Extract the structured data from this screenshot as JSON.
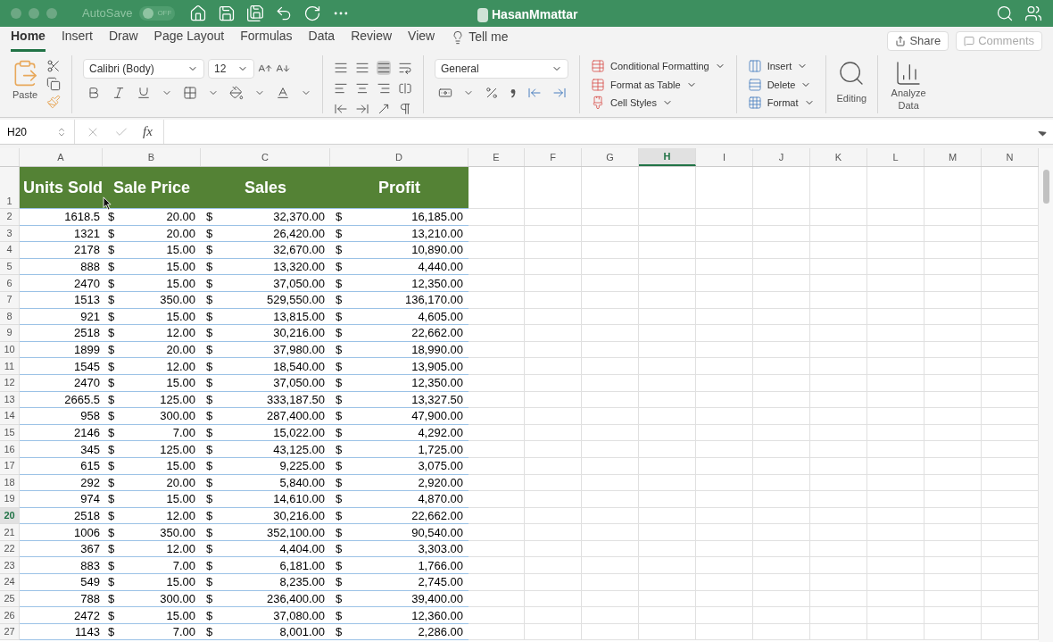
{
  "window": {
    "title": "HasanMmattar",
    "autosave": {
      "label": "AutoSave",
      "toggle": "OFF",
      "on": false
    }
  },
  "tabs": [
    {
      "label": "Home",
      "selected": true
    },
    {
      "label": "Insert",
      "selected": false
    },
    {
      "label": "Draw",
      "selected": false
    },
    {
      "label": "Page Layout",
      "selected": false
    },
    {
      "label": "Formulas",
      "selected": false
    },
    {
      "label": "Data",
      "selected": false
    },
    {
      "label": "Review",
      "selected": false
    },
    {
      "label": "View",
      "selected": false
    }
  ],
  "tell_me": "Tell me",
  "share": "Share",
  "comments": "Comments",
  "ribbon": {
    "paste": "Paste",
    "font": "Calibri (Body)",
    "size": "12",
    "number_format": "General",
    "styles": [
      "Conditional Formatting",
      "Format as Table",
      "Cell Styles"
    ],
    "cells": [
      "Insert",
      "Delete",
      "Format"
    ],
    "editing": "Editing",
    "analyze": "Analyze Data"
  },
  "formula_bar": {
    "name_box": "H20",
    "fx": "fx"
  },
  "sheet": {
    "columns": [
      {
        "label": "A",
        "selected": false
      },
      {
        "label": "B",
        "selected": false
      },
      {
        "label": "C",
        "selected": false
      },
      {
        "label": "D",
        "selected": false
      },
      {
        "label": "E",
        "selected": false
      },
      {
        "label": "F",
        "selected": false
      },
      {
        "label": "G",
        "selected": false
      },
      {
        "label": "H",
        "selected": true
      },
      {
        "label": "I",
        "selected": false
      },
      {
        "label": "J",
        "selected": false
      },
      {
        "label": "K",
        "selected": false
      },
      {
        "label": "L",
        "selected": false
      },
      {
        "label": "M",
        "selected": false
      },
      {
        "label": "N",
        "selected": false
      }
    ],
    "header_row": {
      "number": "1",
      "cells": [
        "Units Sold",
        "Sale Price",
        "Sales",
        "Profit"
      ]
    },
    "rows": [
      {
        "number": "2",
        "selected": false,
        "cells": [
          "1618.5",
          "$",
          "20.00",
          "$",
          "32,370.00",
          "$",
          "16,185.00"
        ]
      },
      {
        "number": "3",
        "selected": false,
        "cells": [
          "1321",
          "$",
          "20.00",
          "$",
          "26,420.00",
          "$",
          "13,210.00"
        ]
      },
      {
        "number": "4",
        "selected": false,
        "cells": [
          "2178",
          "$",
          "15.00",
          "$",
          "32,670.00",
          "$",
          "10,890.00"
        ]
      },
      {
        "number": "5",
        "selected": false,
        "cells": [
          "888",
          "$",
          "15.00",
          "$",
          "13,320.00",
          "$",
          "4,440.00"
        ]
      },
      {
        "number": "6",
        "selected": false,
        "cells": [
          "2470",
          "$",
          "15.00",
          "$",
          "37,050.00",
          "$",
          "12,350.00"
        ]
      },
      {
        "number": "7",
        "selected": false,
        "cells": [
          "1513",
          "$",
          "350.00",
          "$",
          "529,550.00",
          "$",
          "136,170.00"
        ]
      },
      {
        "number": "8",
        "selected": false,
        "cells": [
          "921",
          "$",
          "15.00",
          "$",
          "13,815.00",
          "$",
          "4,605.00"
        ]
      },
      {
        "number": "9",
        "selected": false,
        "cells": [
          "2518",
          "$",
          "12.00",
          "$",
          "30,216.00",
          "$",
          "22,662.00"
        ]
      },
      {
        "number": "10",
        "selected": false,
        "cells": [
          "1899",
          "$",
          "20.00",
          "$",
          "37,980.00",
          "$",
          "18,990.00"
        ]
      },
      {
        "number": "11",
        "selected": false,
        "cells": [
          "1545",
          "$",
          "12.00",
          "$",
          "18,540.00",
          "$",
          "13,905.00"
        ]
      },
      {
        "number": "12",
        "selected": false,
        "cells": [
          "2470",
          "$",
          "15.00",
          "$",
          "37,050.00",
          "$",
          "12,350.00"
        ]
      },
      {
        "number": "13",
        "selected": false,
        "cells": [
          "2665.5",
          "$",
          "125.00",
          "$",
          "333,187.50",
          "$",
          "13,327.50"
        ]
      },
      {
        "number": "14",
        "selected": false,
        "cells": [
          "958",
          "$",
          "300.00",
          "$",
          "287,400.00",
          "$",
          "47,900.00"
        ]
      },
      {
        "number": "15",
        "selected": false,
        "cells": [
          "2146",
          "$",
          "7.00",
          "$",
          "15,022.00",
          "$",
          "4,292.00"
        ]
      },
      {
        "number": "16",
        "selected": false,
        "cells": [
          "345",
          "$",
          "125.00",
          "$",
          "43,125.00",
          "$",
          "1,725.00"
        ]
      },
      {
        "number": "17",
        "selected": false,
        "cells": [
          "615",
          "$",
          "15.00",
          "$",
          "9,225.00",
          "$",
          "3,075.00"
        ]
      },
      {
        "number": "18",
        "selected": false,
        "cells": [
          "292",
          "$",
          "20.00",
          "$",
          "5,840.00",
          "$",
          "2,920.00"
        ]
      },
      {
        "number": "19",
        "selected": false,
        "cells": [
          "974",
          "$",
          "15.00",
          "$",
          "14,610.00",
          "$",
          "4,870.00"
        ]
      },
      {
        "number": "20",
        "selected": true,
        "cells": [
          "2518",
          "$",
          "12.00",
          "$",
          "30,216.00",
          "$",
          "22,662.00"
        ]
      },
      {
        "number": "21",
        "selected": false,
        "cells": [
          "1006",
          "$",
          "350.00",
          "$",
          "352,100.00",
          "$",
          "90,540.00"
        ]
      },
      {
        "number": "22",
        "selected": false,
        "cells": [
          "367",
          "$",
          "12.00",
          "$",
          "4,404.00",
          "$",
          "3,303.00"
        ]
      },
      {
        "number": "23",
        "selected": false,
        "cells": [
          "883",
          "$",
          "7.00",
          "$",
          "6,181.00",
          "$",
          "1,766.00"
        ]
      },
      {
        "number": "24",
        "selected": false,
        "cells": [
          "549",
          "$",
          "15.00",
          "$",
          "8,235.00",
          "$",
          "2,745.00"
        ]
      },
      {
        "number": "25",
        "selected": false,
        "cells": [
          "788",
          "$",
          "300.00",
          "$",
          "236,400.00",
          "$",
          "39,400.00"
        ]
      },
      {
        "number": "26",
        "selected": false,
        "cells": [
          "2472",
          "$",
          "15.00",
          "$",
          "37,080.00",
          "$",
          "12,360.00"
        ]
      },
      {
        "number": "27",
        "selected": false,
        "cells": [
          "1143",
          "$",
          "7.00",
          "$",
          "8,001.00",
          "$",
          "2,286.00"
        ]
      }
    ]
  }
}
